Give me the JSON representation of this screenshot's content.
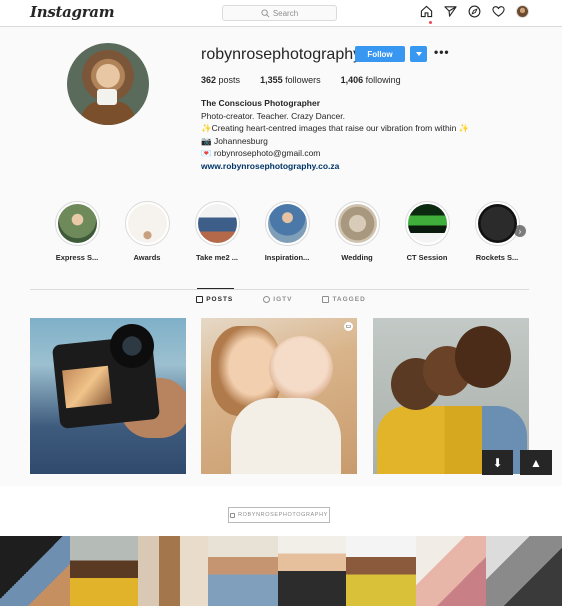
{
  "nav": {
    "logo": "Instagram",
    "search_placeholder": "Search",
    "icons": [
      "home-icon",
      "direct-icon",
      "explore-icon",
      "heart-icon",
      "profile-avatar"
    ]
  },
  "profile": {
    "username": "robynrosephotography",
    "follow_label": "Follow",
    "stats": {
      "posts_count": "362",
      "posts_label": "posts",
      "followers_count": "1,355",
      "followers_label": "followers",
      "following_count": "1,406",
      "following_label": "following"
    },
    "bio": {
      "name": "The Conscious Photographer",
      "line1": "Photo-creator. Teacher. Crazy Dancer.",
      "line2": "✨Creating heart-centred images that raise our vibration from within ✨",
      "line3": "📷 Johannesburg",
      "line4": "💌 robynrosephoto@gmail.com",
      "website": "www.robynrosephotography.co.za"
    }
  },
  "highlights": [
    {
      "label": "Express S..."
    },
    {
      "label": "Awards"
    },
    {
      "label": "Take me2 ..."
    },
    {
      "label": "Inspiration..."
    },
    {
      "label": "Wedding"
    },
    {
      "label": "CT Session"
    },
    {
      "label": "Rockets S..."
    }
  ],
  "tabs": {
    "posts": "POSTS",
    "igtv": "IGTV",
    "tagged": "TAGGED"
  },
  "colors": {
    "accent": "#3897f0",
    "link": "#003569",
    "notification": "#ed4956"
  },
  "embed": {
    "handle": "ROBYNROSEPHOTOGRAPHY"
  }
}
